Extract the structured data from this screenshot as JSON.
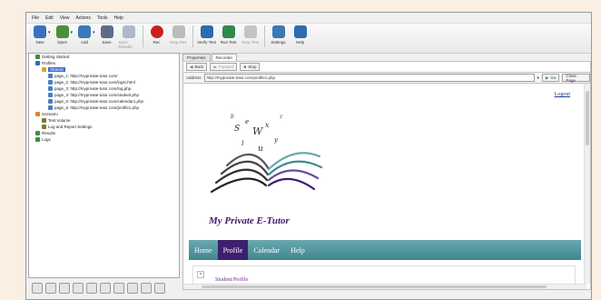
{
  "menu": [
    "File",
    "Edit",
    "View",
    "Actions",
    "Tools",
    "Help"
  ],
  "toolbar": [
    {
      "label": "New",
      "icon": "new-icon",
      "color": "#3a6fc4",
      "enabled": true,
      "caret": true
    },
    {
      "label": "Open",
      "icon": "open-icon",
      "color": "#4a8f3a",
      "enabled": true,
      "caret": true
    },
    {
      "label": "Add",
      "icon": "add-icon",
      "color": "#3a7ab8",
      "enabled": true,
      "caret": true
    },
    {
      "label": "Save",
      "icon": "save-icon",
      "color": "#5a6e8c",
      "enabled": true,
      "caret": false
    },
    {
      "label": "Save Results",
      "icon": "save-results-icon",
      "color": "#5a6e8c",
      "enabled": false,
      "caret": false
    },
    {
      "label": "Rec",
      "icon": "record-icon",
      "color": "#c8201e",
      "enabled": true,
      "caret": false
    },
    {
      "label": "Stop Rec",
      "icon": "stop-record-icon",
      "color": "#777777",
      "enabled": false,
      "caret": false
    },
    {
      "label": "Verify Test",
      "icon": "verify-test-icon",
      "color": "#2f6ab0",
      "enabled": true,
      "caret": false
    },
    {
      "label": "Run Test",
      "icon": "run-test-icon",
      "color": "#2f8a4a",
      "enabled": true,
      "caret": false
    },
    {
      "label": "Stop Test",
      "icon": "stop-test-icon",
      "color": "#888888",
      "enabled": false,
      "caret": false
    },
    {
      "label": "Settings",
      "icon": "settings-icon",
      "color": "#3a78b8",
      "enabled": true,
      "caret": false
    },
    {
      "label": "Help",
      "icon": "help-icon",
      "color": "#2f6ab0",
      "enabled": true,
      "caret": false
    }
  ],
  "tree": [
    {
      "label": "Getting Started",
      "indent": 1,
      "icon": "flag-icon",
      "color": "#3b8f3b",
      "selected": false
    },
    {
      "label": "Profiles",
      "indent": 1,
      "icon": "profiles-icon",
      "color": "#2f6ab0",
      "selected": false
    },
    {
      "label": "Shared",
      "indent": 2,
      "icon": "folder-icon",
      "color": "#d4a72c",
      "selected": true
    },
    {
      "label": "page_1: http://myprivate-tutor.com/",
      "indent": 3,
      "icon": "page-icon",
      "color": "#4a7fc1",
      "selected": false
    },
    {
      "label": "page_2: http://myprivate-tutor.com/login.html",
      "indent": 3,
      "icon": "page-icon",
      "color": "#4a7fc1",
      "selected": false
    },
    {
      "label": "page_3: http://myprivate-tutor.com/log.php",
      "indent": 3,
      "icon": "page-icon",
      "color": "#4a7fc1",
      "selected": false
    },
    {
      "label": "page_4: http://myprivate-tutor.com/student.php",
      "indent": 3,
      "icon": "page-icon",
      "color": "#4a7fc1",
      "selected": false
    },
    {
      "label": "page_5: http://myprivate-tutor.com/calendar1.php",
      "indent": 3,
      "icon": "page-icon",
      "color": "#4a7fc1",
      "selected": false
    },
    {
      "label": "page_6: http://myprivate-tutor.com/profile1.php",
      "indent": 3,
      "icon": "page-icon",
      "color": "#4a7fc1",
      "selected": false
    },
    {
      "label": "Scenario",
      "indent": 1,
      "icon": "scenario-icon",
      "color": "#d48a2c",
      "selected": false
    },
    {
      "label": "Test Volume",
      "indent": 2,
      "icon": "test-volume-icon",
      "color": "#7a7a2c",
      "selected": false
    },
    {
      "label": "Log and Report Settings",
      "indent": 2,
      "icon": "log-settings-icon",
      "color": "#7a7a2c",
      "selected": false
    },
    {
      "label": "Results",
      "indent": 1,
      "icon": "results-icon",
      "color": "#3b8f3b",
      "selected": false
    },
    {
      "label": "Logs",
      "indent": 1,
      "icon": "logs-icon",
      "color": "#3b8f3b",
      "selected": false
    }
  ],
  "tabs": [
    "Properties",
    "Recorder"
  ],
  "active_tab": "Recorder",
  "recorder": {
    "back": "Back",
    "forward": "Forward",
    "stop": "Stop",
    "address_label": "Address",
    "address_value": "http://myprivate-tutor.com/profile1.php",
    "go": "Go",
    "close": "Close Page"
  },
  "site": {
    "logout": "Logout",
    "brand": "My Private E-Tutor",
    "nav": [
      "Home",
      "Profile",
      "Calendar",
      "Help"
    ],
    "active_nav": "Profile",
    "content_title": "Student Profile",
    "broken_image": "×"
  },
  "colors": {
    "accent": "#3d1f6e",
    "nav": "#4e9aa3",
    "selection": "#3b6ec7"
  }
}
